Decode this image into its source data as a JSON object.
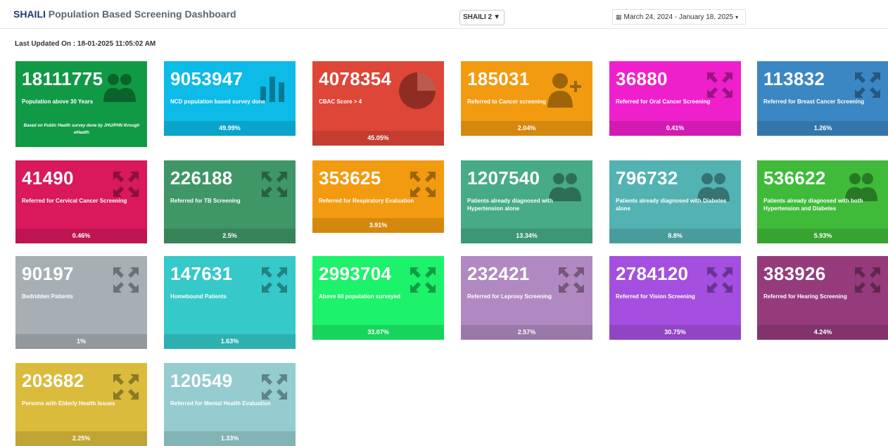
{
  "header": {
    "brand": "SHAILI",
    "title_rest": " Population Based Screening Dashboard",
    "select_value": "SHAILI 2",
    "date_range": "March 24, 2024 - January 18, 2025"
  },
  "last_updated": "Last Updated On : 18-01-2025 11:05:02 AM",
  "tiles": [
    {
      "value": "18111775",
      "label": "Population above 30 Years",
      "note": "Based on Public Health survey done by JHU/PHN through eHealth",
      "percent": "",
      "color": "#119a45",
      "icon": "people-icon"
    },
    {
      "value": "9053947",
      "label": "NCD population based survey done",
      "note": "",
      "percent": "49.99%",
      "color": "#0cbbe8",
      "icon": "bar-chart-icon"
    },
    {
      "value": "4078354",
      "label": "CBAC Score > 4",
      "note": "",
      "percent": "45.05%",
      "color": "#de4637",
      "icon": "pie-chart-icon"
    },
    {
      "value": "185031",
      "label": "Referred to Cancer screening",
      "note": "",
      "percent": "2.04%",
      "color": "#f39b10",
      "icon": "user-plus-icon"
    },
    {
      "value": "36880",
      "label": "Referred for Oral Cancer Screening",
      "note": "",
      "percent": "0.41%",
      "color": "#f01fcc",
      "icon": "expand-icon"
    },
    {
      "value": "113832",
      "label": "Referred for Breast Cancer Screening",
      "note": "",
      "percent": "1.26%",
      "color": "#3b87c4",
      "icon": "expand-icon"
    },
    {
      "value": "41490",
      "label": "Referred for Cervical Cancer Screening",
      "note": "",
      "percent": "0.46%",
      "color": "#d9185e",
      "icon": "expand-icon"
    },
    {
      "value": "226188",
      "label": "Referred for TB Screening",
      "note": "",
      "percent": "2.5%",
      "color": "#3f9667",
      "icon": "expand-icon"
    },
    {
      "value": "353625",
      "label": "Referred for Respiratory Evaluation",
      "note": "",
      "percent": "3.91%",
      "color": "#f39b10",
      "icon": "expand-icon"
    },
    {
      "value": "1207540",
      "label": "Patients already diagnosed with Hypertension alone",
      "note": "",
      "percent": "13.34%",
      "color": "#46ab86",
      "icon": "people-icon"
    },
    {
      "value": "796732",
      "label": "Patients already diagnosed with Diabetes alone",
      "note": "",
      "percent": "8.8%",
      "color": "#52b3b2",
      "icon": "people-icon"
    },
    {
      "value": "536622",
      "label": "Patients already diagnosed with both Hypertension and Diabetes",
      "note": "",
      "percent": "5.93%",
      "color": "#3fbb39",
      "icon": "people-icon"
    },
    {
      "value": "90197",
      "label": "Bedridden Patients",
      "note": "",
      "percent": "1%",
      "color": "#a7afb4",
      "icon": "expand-icon"
    },
    {
      "value": "147631",
      "label": "Homebound Patients",
      "note": "",
      "percent": "1.63%",
      "color": "#36c9c9",
      "icon": "expand-icon"
    },
    {
      "value": "2993704",
      "label": "Above 60 population surveyed",
      "note": "",
      "percent": "33.07%",
      "color": "#1cf26a",
      "icon": "expand-icon"
    },
    {
      "value": "232421",
      "label": "Referred for Leprosy Screening",
      "note": "",
      "percent": "2.57%",
      "color": "#b189c2",
      "icon": "expand-icon"
    },
    {
      "value": "2784120",
      "label": "Referred for Vision Screening",
      "note": "",
      "percent": "30.75%",
      "color": "#a44fe0",
      "icon": "expand-icon"
    },
    {
      "value": "383926",
      "label": "Referred for Hearing Screening",
      "note": "",
      "percent": "4.24%",
      "color": "#953b7b",
      "icon": "expand-icon"
    },
    {
      "value": "203682",
      "label": "Persons with Elderly Health Issues",
      "note": "",
      "percent": "2.25%",
      "color": "#dbbb3c",
      "icon": "expand-icon"
    },
    {
      "value": "120549",
      "label": "Referred for Mental Health Evaluation",
      "note": "",
      "percent": "1.33%",
      "color": "#94cccf",
      "icon": "expand-icon"
    }
  ]
}
